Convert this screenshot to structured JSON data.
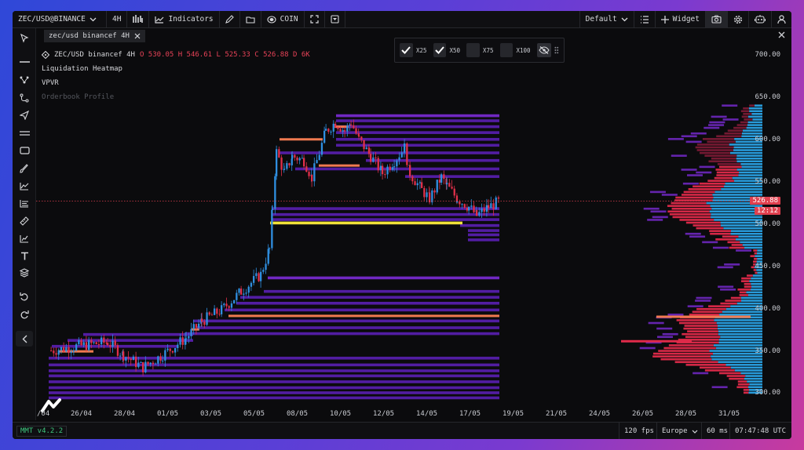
{
  "topbar": {
    "symbol": "ZEC/USD@BINANCEF",
    "interval": "4H",
    "indicators_label": "Indicators",
    "coin_label": "COIN",
    "layout": "Default",
    "widget_label": "Widget"
  },
  "tab": {
    "label": "zec/usd binancef 4H"
  },
  "legend": {
    "title": "ZEC/USD binancef 4H",
    "ohlc": "O 530.05 H 546.61 L 525.33 C 526.88 D 6K",
    "layer_1": "Liquidation Heatmap",
    "layer_2": "VPVR",
    "layer_3": "Orderbook Profile"
  },
  "controls": {
    "items": [
      {
        "label": "X25",
        "checked": true
      },
      {
        "label": "X50",
        "checked": true
      },
      {
        "label": "X75",
        "checked": false
      },
      {
        "label": "X100",
        "checked": false
      }
    ]
  },
  "price_axis": {
    "ticks": [
      "700.00",
      "650.00",
      "600.00",
      "550.00",
      "500.00",
      "450.00",
      "400.00",
      "350.00",
      "300.00"
    ],
    "last_price": "526.88",
    "countdown": "12:12"
  },
  "time_axis": {
    "ticks": [
      "/04",
      "26/04",
      "28/04",
      "01/05",
      "03/05",
      "05/05",
      "08/05",
      "10/05",
      "12/05",
      "14/05",
      "17/05",
      "19/05",
      "21/05",
      "24/05",
      "26/05",
      "28/05",
      "31/05"
    ]
  },
  "status": {
    "version": "MMT v4.2.2",
    "fps": "120 fps",
    "region": "Europe",
    "latency": "60 ms",
    "clock": "07:47:48 UTC"
  },
  "colors": {
    "up": "#2f8fe0",
    "down": "#e0304a",
    "liq_band": "#5a1fb3",
    "liq_bright": "#7b2bd6",
    "hot_orange": "#f07a50",
    "hot_yellow": "#f2e23a",
    "vp_blue": "#2aa3e6",
    "vp_red": "#e02a4a"
  }
}
